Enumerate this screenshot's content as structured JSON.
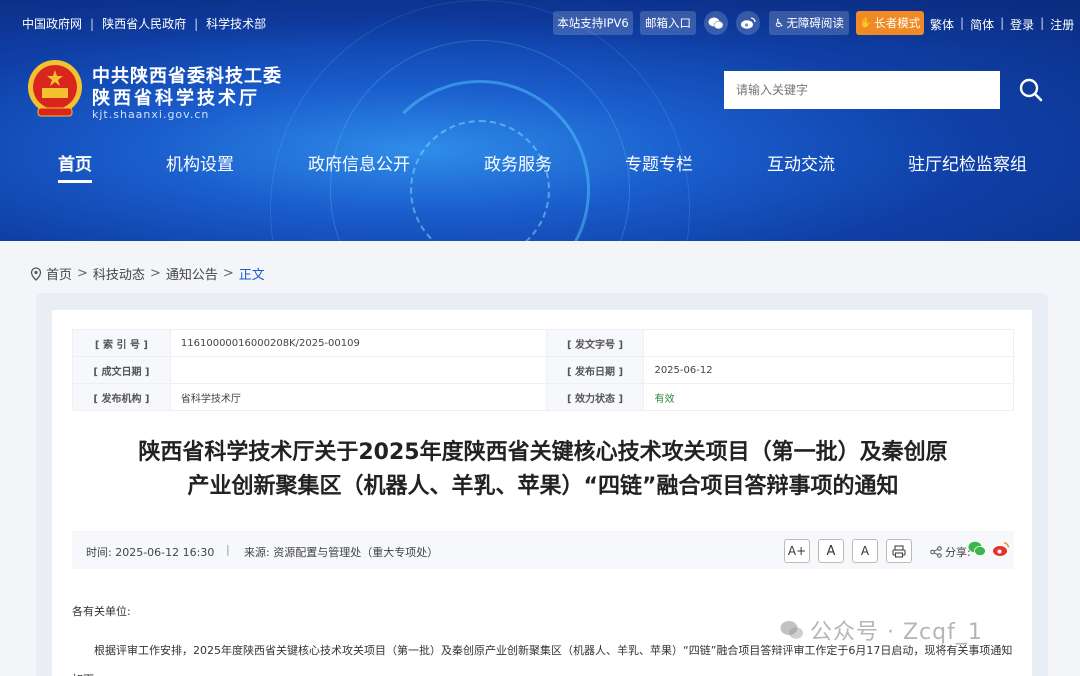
{
  "topbar": {
    "links": [
      "中国政府网",
      "陕西省人民政府",
      "科学技术部"
    ],
    "ipv6": "本站支持IPV6",
    "mail": "邮箱入口",
    "accessibility": "无障碍阅读",
    "elder": "长者模式",
    "right_links": [
      "繁体",
      "简体",
      "登录",
      "注册"
    ]
  },
  "site": {
    "title1": "中共陕西省委科技工委",
    "title2": "陕西省科学技术厅",
    "domain": "kjt.shaanxi.gov.cn"
  },
  "search": {
    "placeholder": "请输入关键字"
  },
  "nav": [
    "首页",
    "机构设置",
    "政府信息公开",
    "政务服务",
    "专题专栏",
    "互动交流",
    "驻厅纪检监察组"
  ],
  "breadcrumb": {
    "items": [
      "首页",
      "科技动态",
      "通知公告"
    ],
    "current": "正文"
  },
  "meta": {
    "index_label": "[ 索 引 号 ]",
    "index_value": "11610000016000208K/2025-00109",
    "docno_label": "[ 发文字号 ]",
    "docno_value": "",
    "created_label": "[ 成文日期 ]",
    "created_value": "",
    "published_label": "[ 发布日期 ]",
    "published_value": "2025-06-12",
    "org_label": "[ 发布机构 ]",
    "org_value": "省科学技术厅",
    "status_label": "[ 效力状态 ]",
    "status_value": "有效"
  },
  "document": {
    "title_line1": "陕西省科学技术厅关于2025年度陕西省关键核心技术攻关项目（第一批）及秦创原",
    "title_line2": "产业创新聚集区（机器人、羊乳、苹果）“四链”融合项目答辩事项的通知",
    "time": "时间:   2025-06-12 16:30",
    "source": "来源:   资源配置与管理处（重大专项处）",
    "share_label": "分享:",
    "salutation": "各有关单位:",
    "para1": "根据评审工作安排，2025年度陕西省关键核心技术攻关项目（第一批）及秦创原产业创新聚集区（机器人、羊乳、苹果）“四链”融合项目答辩评审工作定于6月17日启动，现将有关事项通知如下。"
  },
  "font_buttons": {
    "large": "A+",
    "medium": "A",
    "small": "A"
  },
  "watermark": "公众号 · Zcqf_1",
  "colors": {
    "accent": "#1a5dcc",
    "elder_button": "#f08a24",
    "valid_status": "#2f8b3a"
  }
}
